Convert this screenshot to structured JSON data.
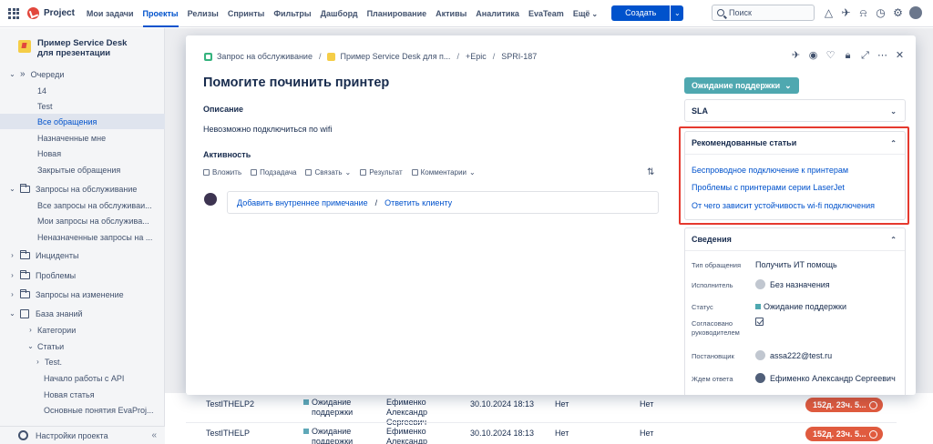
{
  "app": {
    "brand": "Project",
    "nav": [
      "Мои задачи",
      "Проекты",
      "Релизы",
      "Спринты",
      "Фильтры",
      "Дашборд",
      "Планирование",
      "Активы",
      "Аналитика",
      "EvaTeam",
      "Ещё"
    ],
    "active_nav": "Проекты",
    "create_label": "Создать",
    "search_placeholder": "Поиск"
  },
  "sidebar": {
    "project_name": "Пример Service Desk для презентации",
    "items": {
      "queues": "Очереди",
      "q14": "14",
      "qtest": "Test",
      "qall": "Все обращения",
      "qassigned": "Назначенные мне",
      "qnew": "Новая",
      "qclosed": "Закрытые обращения",
      "requests": "Запросы на обслуживание",
      "r_all": "Все запросы на обслуживаи...",
      "r_mine": "Мои запросы на обслужива...",
      "r_unassigned": "Неназначенные запросы на ...",
      "incidents": "Инциденты",
      "problems": "Проблемы",
      "changes": "Запросы на изменение",
      "kb": "База знаний",
      "categories": "Категории",
      "articles": "Статьи",
      "a_test": "Test.",
      "a_api": "Начало работы с API",
      "a_new": "Новая статья",
      "a_basics": "Основные понятия EvaProj..."
    },
    "settings": "Настройки проекта"
  },
  "bg_table": {
    "rows": [
      {
        "id": "TestITHELP2",
        "status": "Ожидание поддержки",
        "person": "Ефименко Александр Сергеевич",
        "date": "30.10.2024 18:13",
        "c1": "Нет",
        "c2": "Нет",
        "sla": "152д. 23ч. 5..."
      },
      {
        "id": "TestITHELP",
        "status": "Ожидание поддержки",
        "person": "Ефименко Александр Сергеевич",
        "date": "30.10.2024 18:13",
        "c1": "Нет",
        "c2": "Нет",
        "sla": "152д. 23ч. 5..."
      }
    ]
  },
  "modal": {
    "breadcrumb": {
      "type": "Запрос на обслуживание",
      "project": "Пример Service Desk для п...",
      "epic": "+Epic",
      "key": "SPRI-187"
    },
    "title": "Помогите починить принтер",
    "description_label": "Описание",
    "description": "Невозможно подключиться по wifi",
    "activity_label": "Активность",
    "actions": [
      "Вложить",
      "Подзадача",
      "Связать",
      "Результат",
      "Комментарии"
    ],
    "internal_note": "Добавить внутреннее примечание",
    "reply_client": "Ответить клиенту",
    "status_button": "Ожидание поддержки",
    "sla_label": "SLA",
    "recommended": {
      "title": "Рекомендованные статьи",
      "links": [
        "Беспроводное подключение к принтерам",
        "Проблемы с принтерами серии LaserJet",
        "От чего зависит устойчивость wi-fi подключения"
      ]
    },
    "details": {
      "title": "Сведения",
      "fields": {
        "req_type_label": "Тип обращения",
        "req_type": "Получить ИТ помощь",
        "assignee_label": "Исполнитель",
        "assignee": "Без назначения",
        "status_label": "Статус",
        "status": "Ожидание поддержки",
        "approved_label": "Согласовано руководителем",
        "reporter_label": "Постановщик",
        "reporter": "assa222@test.ru",
        "waiting_label": "Ждем ответа",
        "waiting": "Ефименко Александр Сергеевич"
      }
    }
  }
}
